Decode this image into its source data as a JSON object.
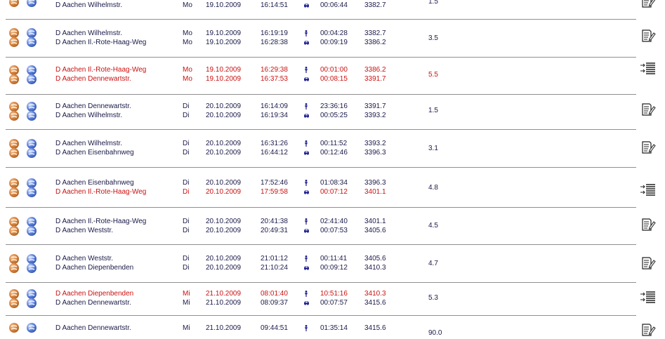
{
  "table": {
    "rows": [
      {
        "highlight": false,
        "lines": [
          {
            "place": "D Aachen Wilhelmstr.",
            "day": "Mo",
            "date": "19.10.2009",
            "time": "16:14:51",
            "mode": "car-icon",
            "duration": "00:06:44",
            "km": "3382.7",
            "red": false
          }
        ],
        "distance": "1.5",
        "action": "document-edit-icon"
      },
      {
        "highlight": false,
        "lines": [
          {
            "place": "D Aachen Wilhelmstr.",
            "day": "Mo",
            "date": "19.10.2009",
            "time": "16:19:19",
            "mode": "walk-icon",
            "duration": "00:04:28",
            "km": "3382.7",
            "red": false
          },
          {
            "place": "D Aachen Il.-Rote-Haag-Weg",
            "day": "Mo",
            "date": "19.10.2009",
            "time": "16:28:38",
            "mode": "car-icon",
            "duration": "00:09:19",
            "km": "3386.2",
            "red": false
          }
        ],
        "distance": "3.5",
        "action": "document-edit-icon"
      },
      {
        "highlight": true,
        "lines": [
          {
            "place": "D Aachen Il.-Rote-Haag-Weg",
            "day": "Mo",
            "date": "19.10.2009",
            "time": "16:29:38",
            "mode": "walk-icon",
            "duration": "00:01:00",
            "km": "3386.2",
            "red": true
          },
          {
            "place": "D Aachen Dennewartstr.",
            "day": "Mo",
            "date": "19.10.2009",
            "time": "16:37:53",
            "mode": "car-icon",
            "duration": "00:08:15",
            "km": "3391.7",
            "red": true
          }
        ],
        "distance": "5.5",
        "action": "merge-list-icon"
      },
      {
        "highlight": false,
        "lines": [
          {
            "place": "D Aachen Dennewartstr.",
            "day": "Di",
            "date": "20.10.2009",
            "time": "16:14:09",
            "mode": "walk-icon",
            "duration": "23:36:16",
            "km": "3391.7",
            "red": false
          },
          {
            "place": "D Aachen Wilhelmstr.",
            "day": "Di",
            "date": "20.10.2009",
            "time": "16:19:34",
            "mode": "car-icon",
            "duration": "00:05:25",
            "km": "3393.2",
            "red": false
          }
        ],
        "distance": "1.5",
        "action": "document-edit-icon"
      },
      {
        "highlight": false,
        "lines": [
          {
            "place": "D Aachen Wilhelmstr.",
            "day": "Di",
            "date": "20.10.2009",
            "time": "16:31:26",
            "mode": "walk-icon",
            "duration": "00:11:52",
            "km": "3393.2",
            "red": false
          },
          {
            "place": "D Aachen Eisenbahnweg",
            "day": "Di",
            "date": "20.10.2009",
            "time": "16:44:12",
            "mode": "car-icon",
            "duration": "00:12:46",
            "km": "3396.3",
            "red": false
          }
        ],
        "distance": "3.1",
        "action": "document-edit-icon"
      },
      {
        "highlight": false,
        "lines": [
          {
            "place": "D Aachen Eisenbahnweg",
            "day": "Di",
            "date": "20.10.2009",
            "time": "17:52:46",
            "mode": "walk-icon",
            "duration": "01:08:34",
            "km": "3396.3",
            "red": false
          },
          {
            "place": "D Aachen Il.-Rote-Haag-Weg",
            "day": "Di",
            "date": "20.10.2009",
            "time": "17:59:58",
            "mode": "car-icon",
            "duration": "00:07:12",
            "km": "3401.1",
            "red": true
          }
        ],
        "distance": "4.8",
        "action": "merge-list-icon"
      },
      {
        "highlight": false,
        "lines": [
          {
            "place": "D Aachen Il.-Rote-Haag-Weg",
            "day": "Di",
            "date": "20.10.2009",
            "time": "20:41:38",
            "mode": "walk-icon",
            "duration": "02:41:40",
            "km": "3401.1",
            "red": false
          },
          {
            "place": "D Aachen Weststr.",
            "day": "Di",
            "date": "20.10.2009",
            "time": "20:49:31",
            "mode": "car-icon",
            "duration": "00:07:53",
            "km": "3405.6",
            "red": false
          }
        ],
        "distance": "4.5",
        "action": "document-edit-icon"
      },
      {
        "highlight": false,
        "lines": [
          {
            "place": "D Aachen Weststr.",
            "day": "Di",
            "date": "20.10.2009",
            "time": "21:01:12",
            "mode": "walk-icon",
            "duration": "00:11:41",
            "km": "3405.6",
            "red": false
          },
          {
            "place": "D Aachen Diepenbenden",
            "day": "Di",
            "date": "20.10.2009",
            "time": "21:10:24",
            "mode": "car-icon",
            "duration": "00:09:12",
            "km": "3410.3",
            "red": false
          }
        ],
        "distance": "4.7",
        "action": "document-edit-icon"
      },
      {
        "highlight": false,
        "lines": [
          {
            "place": "D Aachen Diepenbenden",
            "day": "Mi",
            "date": "21.10.2009",
            "time": "08:01:40",
            "mode": "walk-icon",
            "duration": "10:51:16",
            "km": "3410.3",
            "red": true
          },
          {
            "place": "D Aachen Dennewartstr.",
            "day": "Mi",
            "date": "21.10.2009",
            "time": "08:09:37",
            "mode": "car-icon",
            "duration": "00:07:57",
            "km": "3415.6",
            "red": false
          }
        ],
        "distance": "5.3",
        "action": "merge-list-icon"
      },
      {
        "highlight": false,
        "lines": [
          {
            "place": "D Aachen Dennewartstr.",
            "day": "Mi",
            "date": "21.10.2009",
            "time": "09:44:51",
            "mode": "walk-icon",
            "duration": "01:35:14",
            "km": "3415.6",
            "red": false
          }
        ],
        "distance": "90.0",
        "action": "document-edit-icon"
      }
    ]
  },
  "colors": {
    "text": "#1a1a4a",
    "highlight": "#cc1111",
    "separator": "#8f8f8f"
  }
}
